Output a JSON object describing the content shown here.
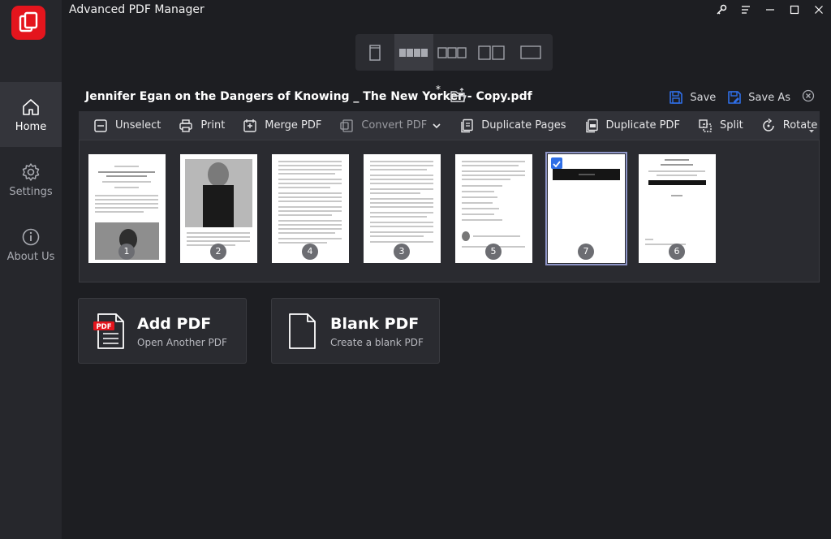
{
  "app": {
    "title": "Advanced PDF Manager"
  },
  "sidebar": {
    "items": [
      {
        "label": "Home",
        "icon": "home-icon"
      },
      {
        "label": "Settings",
        "icon": "gear-icon"
      },
      {
        "label": "About Us",
        "icon": "info-icon"
      }
    ]
  },
  "window_controls": [
    "key-icon",
    "menu-icon",
    "minimize-icon",
    "maximize-icon",
    "close-icon"
  ],
  "view_modes": [
    "single-page-view",
    "thumbnail-strip-view",
    "three-column-view",
    "two-column-view",
    "full-page-view"
  ],
  "document": {
    "file_name": "Jennifer Egan on the Dangers of Knowing _ The New Yorker - Copy.pdf",
    "modified_mark": "*",
    "save_label": "Save",
    "save_as_label": "Save As"
  },
  "toolbar": {
    "unselect": "Unselect",
    "print": "Print",
    "merge_pdf": "Merge PDF",
    "convert_pdf": "Convert PDF",
    "duplicate_pages": "Duplicate Pages",
    "duplicate_pdf": "Duplicate PDF",
    "split": "Split",
    "rotate": "Rotate"
  },
  "pages": [
    {
      "number": "1",
      "selected": false
    },
    {
      "number": "2",
      "selected": false
    },
    {
      "number": "4",
      "selected": false
    },
    {
      "number": "3",
      "selected": false
    },
    {
      "number": "5",
      "selected": false
    },
    {
      "number": "7",
      "selected": true
    },
    {
      "number": "6",
      "selected": false
    }
  ],
  "cards": {
    "add_pdf": {
      "title": "Add PDF",
      "subtitle": "Open Another PDF",
      "badge": "PDF"
    },
    "blank_pdf": {
      "title": "Blank PDF",
      "subtitle": "Create a blank PDF"
    }
  },
  "colors": {
    "accent": "#2f6ee6",
    "logo": "#e4151d",
    "badge": "#e4151d"
  }
}
